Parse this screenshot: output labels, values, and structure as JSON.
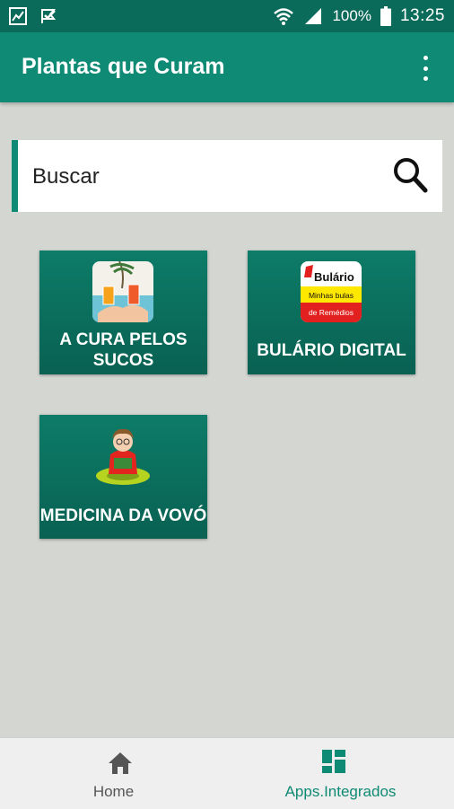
{
  "status_bar": {
    "left_icons": [
      "gallery-icon",
      "check-flag-icon"
    ],
    "battery": "100%",
    "time": "13:25"
  },
  "app_bar": {
    "title": "Plantas que Curam",
    "menu_icon": "more-vert-icon"
  },
  "search": {
    "placeholder": "Buscar",
    "icon": "search-icon"
  },
  "tiles": [
    {
      "label": "A CURA PELOS SUCOS",
      "icon": "juice-icon"
    },
    {
      "label": "BULÁRIO DIGITAL",
      "icon": "bulario-logo",
      "logo_text": {
        "brand": "Bulário",
        "line1": "Minhas bulas",
        "line2": "de Remédios"
      }
    },
    {
      "label": "MEDICINA DA VOVÓ",
      "icon": "grandma-icon"
    }
  ],
  "bottom_nav": {
    "items": [
      {
        "label": "Home",
        "icon": "home-icon",
        "active": false
      },
      {
        "label": "Apps.Integrados",
        "icon": "dashboard-icon",
        "active": true
      }
    ]
  },
  "colors": {
    "status_bar": "#0b6b5b",
    "primary": "#0f8a74",
    "background": "#d3d6d1",
    "tile_top": "#0d7c68",
    "tile_bottom": "#096152",
    "active_nav": "#0f8a74",
    "inactive_nav": "#555555"
  }
}
